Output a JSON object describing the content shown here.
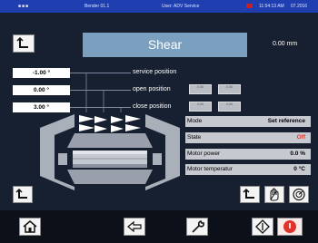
{
  "topbar": {
    "left_text": "Bender 01.1",
    "center_text": "User: ADV Service",
    "time": "11:54:13 AM",
    "date": "07.2016"
  },
  "header": {
    "title": "Shear",
    "distance": "0.00 mm"
  },
  "positions": [
    {
      "value": "-1.00 °",
      "label": "service position"
    },
    {
      "value": "0.00 °",
      "label": "open position"
    },
    {
      "value": "3.00 °",
      "label": "close position"
    }
  ],
  "small_buttons": [
    "0.00",
    "0.00",
    "0.00",
    "0.00"
  ],
  "status": [
    {
      "label": "Mode",
      "value": "Set reference"
    },
    {
      "label": "State",
      "value": "Off",
      "color": "#e53a2a"
    },
    {
      "label": "Motor power",
      "value": "0.0 %"
    },
    {
      "label": "Motor temperatur",
      "value": "0 °C"
    }
  ],
  "icons": [
    "mode-toggle-icon",
    "home-icon",
    "back-arrow-icon",
    "wrench-icon",
    "start-icon",
    "stop-icon",
    "hand-icon",
    "dial-icon"
  ]
}
